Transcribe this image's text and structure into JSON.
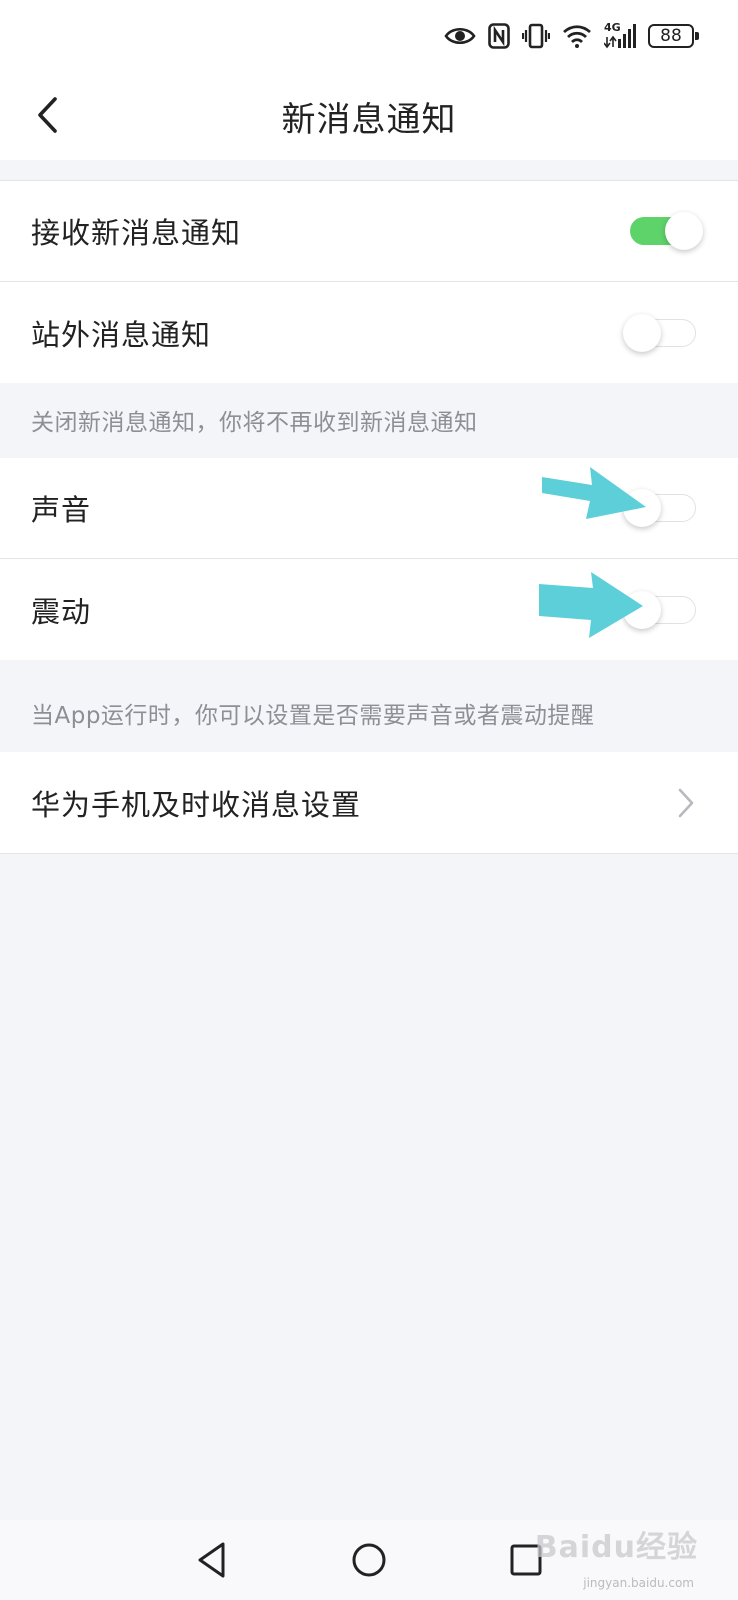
{
  "status_bar": {
    "network_label": "4G",
    "battery_level": "88"
  },
  "header": {
    "title": "新消息通知"
  },
  "group_notifications": {
    "items": [
      {
        "label": "接收新消息通知",
        "enabled": true
      },
      {
        "label": "站外消息通知",
        "enabled": false
      }
    ],
    "hint": "关闭新消息通知，你将不再收到新消息通知"
  },
  "group_alerts": {
    "items": [
      {
        "label": "声音",
        "enabled": false
      },
      {
        "label": "震动",
        "enabled": false
      }
    ],
    "hint": "当App运行时，你可以设置是否需要声音或者震动提醒"
  },
  "group_device": {
    "items": [
      {
        "label": "华为手机及时收消息设置"
      }
    ]
  },
  "colors": {
    "toggle_on": "#5ed36a",
    "annotation_arrow": "#5ccfd9",
    "background": "#f4f5f9"
  },
  "watermark": {
    "text": "Baidu经验",
    "sub": "jingyan.baidu.com"
  }
}
